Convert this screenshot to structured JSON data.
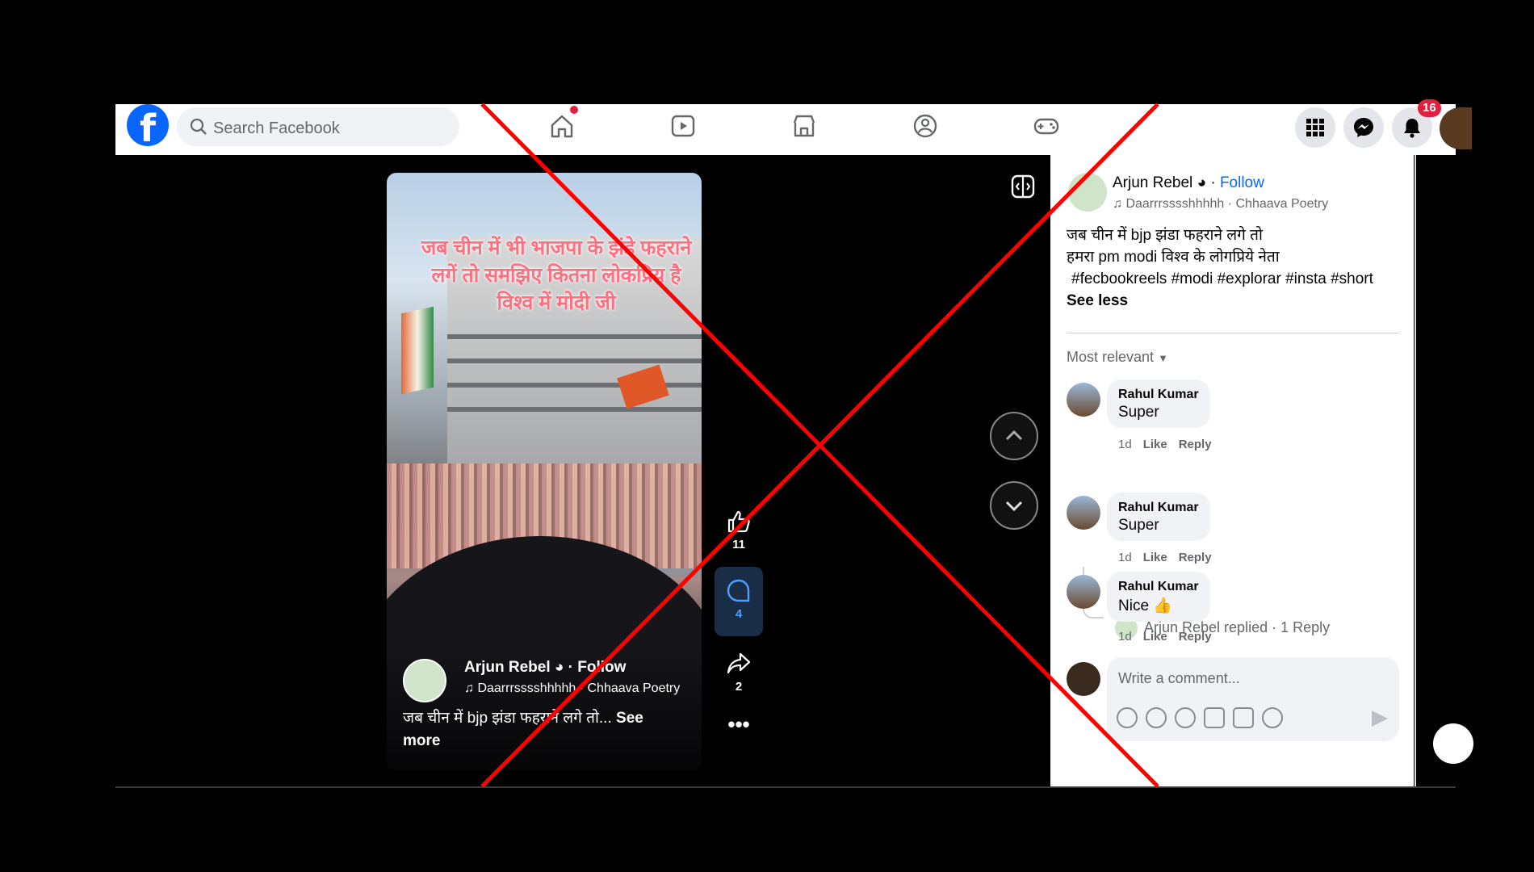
{
  "topbar": {
    "search_placeholder": "Search Facebook",
    "notification_count": "16",
    "nav_icons": [
      "home-icon",
      "watch-icon",
      "marketplace-icon",
      "groups-icon",
      "gaming-icon"
    ]
  },
  "reel": {
    "overlay_text": "जब चीन में भी भाजपा के झंडे फहराने लगें तो समझिए कितना लोकप्रिय है विश्व में मोदी जी",
    "author_name": "Arjun Rebel",
    "follow_label": "Follow",
    "music": "Daarrrsssshhhhh · Chhaava Poetry",
    "caption": "जब चीन में bjp झंडा फहराने लगे तो...",
    "see_more": "See more",
    "likes": "11",
    "comments": "4",
    "shares": "2"
  },
  "panel": {
    "author_name": "Arjun Rebel",
    "follow_label": "Follow",
    "music": "Daarrrsssshhhhh · Chhaava Poetry",
    "caption_line1": "जब चीन में bjp झंडा फहराने लगे तो",
    "caption_line2": "हमरा pm modi विश्व के लोगप्रिये नेता",
    "hashtags": "#fecbookreels #modi #explorar #insta #short",
    "see_less": "See less",
    "sort_label": "Most relevant",
    "comments": [
      {
        "name": "Rahul Kumar",
        "text": "Super",
        "time": "1d",
        "like": "Like",
        "reply": "Reply"
      },
      {
        "name": "Rahul Kumar",
        "text": "Super",
        "time": "1d",
        "like": "Like",
        "reply": "Reply"
      },
      {
        "name": "Rahul Kumar",
        "text": "Nice 👍",
        "time": "1d",
        "like": "Like",
        "reply": "Reply"
      }
    ],
    "reply_summary": "Arjun Rebel replied · 1 Reply",
    "write_placeholder": "Write a comment..."
  },
  "colors": {
    "brand": "#0866ff",
    "overlay_x": "#ff0000"
  }
}
